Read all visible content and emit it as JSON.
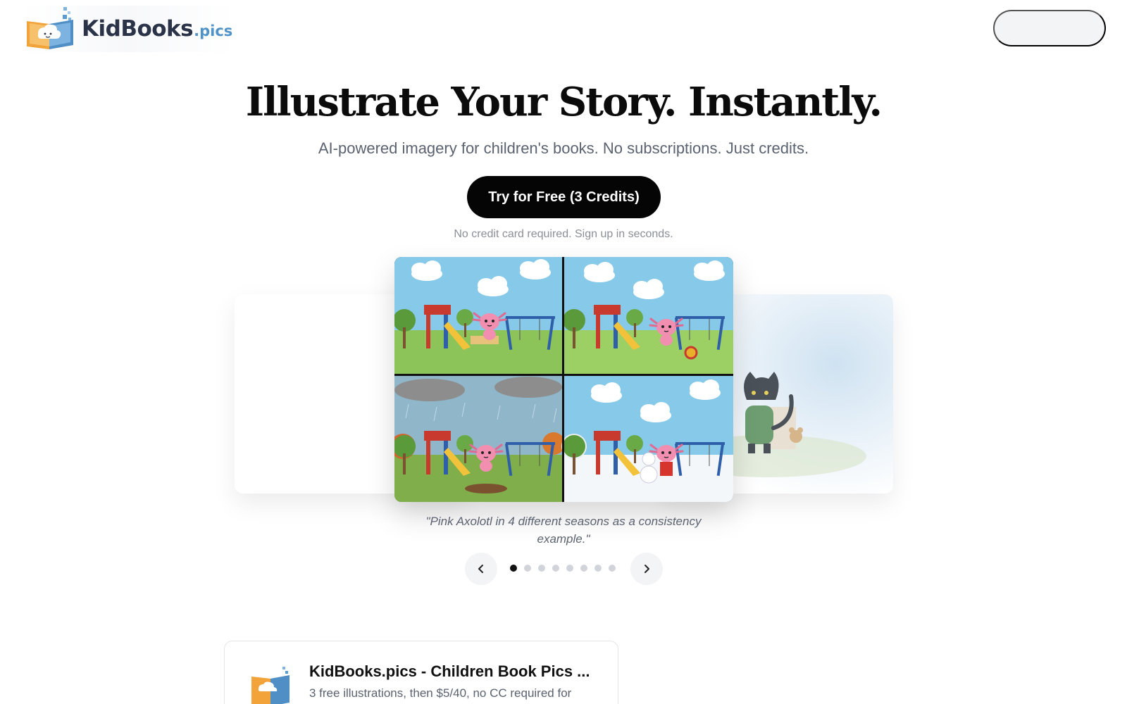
{
  "header": {
    "logo_name": "KidBooks",
    "logo_tld": ".pics"
  },
  "hero": {
    "title": "Illustrate Your Story. Instantly.",
    "subtitle": "AI-powered imagery for children's books. No subscriptions. Just credits.",
    "cta_label": "Try for Free (3 Credits)",
    "cta_note": "No credit card required. Sign up in seconds."
  },
  "carousel": {
    "caption": "\"Pink Axolotl in 4 different seasons as a consistency example.\"",
    "slide_count": 8,
    "active_index": 0
  },
  "embed_card": {
    "title": "KidBooks.pics - Children Book Pics ...",
    "description": "3 free illustrations, then $5/40, no CC required for"
  },
  "colors": {
    "cta_bg": "#050505",
    "brand_navy": "#2a3347",
    "brand_blue": "#4f93c8",
    "brand_orange": "#f2a33a"
  }
}
